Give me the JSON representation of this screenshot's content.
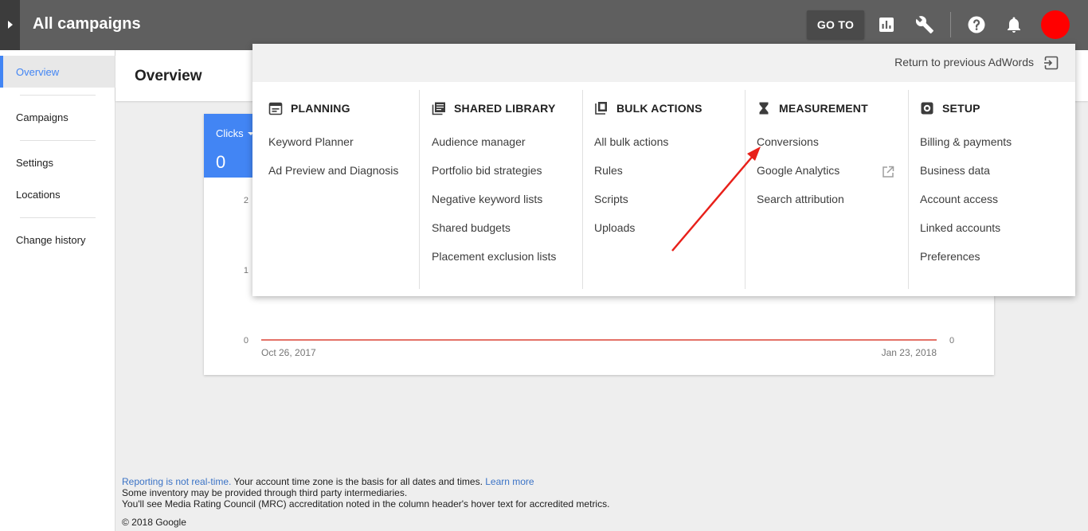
{
  "header": {
    "title": "All campaigns",
    "goto_label": "GO TO",
    "icons": [
      "reports-icon",
      "tools-icon",
      "help-icon",
      "notifications-icon"
    ],
    "avatar_color": "#ff0000"
  },
  "sidebar": {
    "items": [
      {
        "label": "Overview",
        "active": true
      },
      {
        "label": "Campaigns"
      },
      {
        "label": "Settings"
      },
      {
        "label": "Locations"
      },
      {
        "label": "Change history"
      }
    ]
  },
  "main": {
    "page_title": "Overview",
    "metric": {
      "label": "Clicks",
      "value": "0",
      "color": "#4285f4"
    }
  },
  "chart_data": {
    "type": "line",
    "series": [
      {
        "values": [
          0,
          0
        ]
      }
    ],
    "x": [
      "Oct 26, 2017",
      "Jan 23, 2018"
    ],
    "x_tick_labels": [
      "Oct 26, 2017",
      "Jan 23, 2018"
    ],
    "y_tick_labels": [
      "0",
      "1",
      "2"
    ],
    "y_right_tick_labels": [
      "0"
    ],
    "ylim": [
      0,
      2
    ],
    "line_color": "#db4437",
    "grid": false
  },
  "dropdown": {
    "return_label": "Return to previous AdWords",
    "columns": [
      {
        "heading": "PLANNING",
        "icon": "calendar-icon",
        "items": [
          "Keyword Planner",
          "Ad Preview and Diagnosis"
        ]
      },
      {
        "heading": "SHARED LIBRARY",
        "icon": "library-icon",
        "items": [
          "Audience manager",
          "Portfolio bid strategies",
          "Negative keyword lists",
          "Shared budgets",
          "Placement exclusion lists"
        ]
      },
      {
        "heading": "BULK ACTIONS",
        "icon": "copy-icon",
        "items": [
          "All bulk actions",
          "Rules",
          "Scripts",
          "Uploads"
        ]
      },
      {
        "heading": "MEASUREMENT",
        "icon": "hourglass-icon",
        "items": [
          "Conversions",
          "Google Analytics",
          "Search attribution"
        ]
      },
      {
        "heading": "SETUP",
        "icon": "settings-icon",
        "items": [
          "Billing & payments",
          "Business data",
          "Account access",
          "Linked accounts",
          "Preferences"
        ]
      }
    ],
    "external_link_icon": "open-in-new-icon"
  },
  "annotation": {
    "arrow_color": "#e8201a"
  },
  "footer": {
    "link1": "Reporting is not real-time.",
    "text1": " Your account time zone is the basis for all dates and times. ",
    "link2": "Learn more",
    "line2": "Some inventory may be provided through third party intermediaries.",
    "line3": "You'll see Media Rating Council (MRC) accreditation noted in the column header's hover text for accredited metrics.",
    "copyright": "© 2018 Google"
  }
}
